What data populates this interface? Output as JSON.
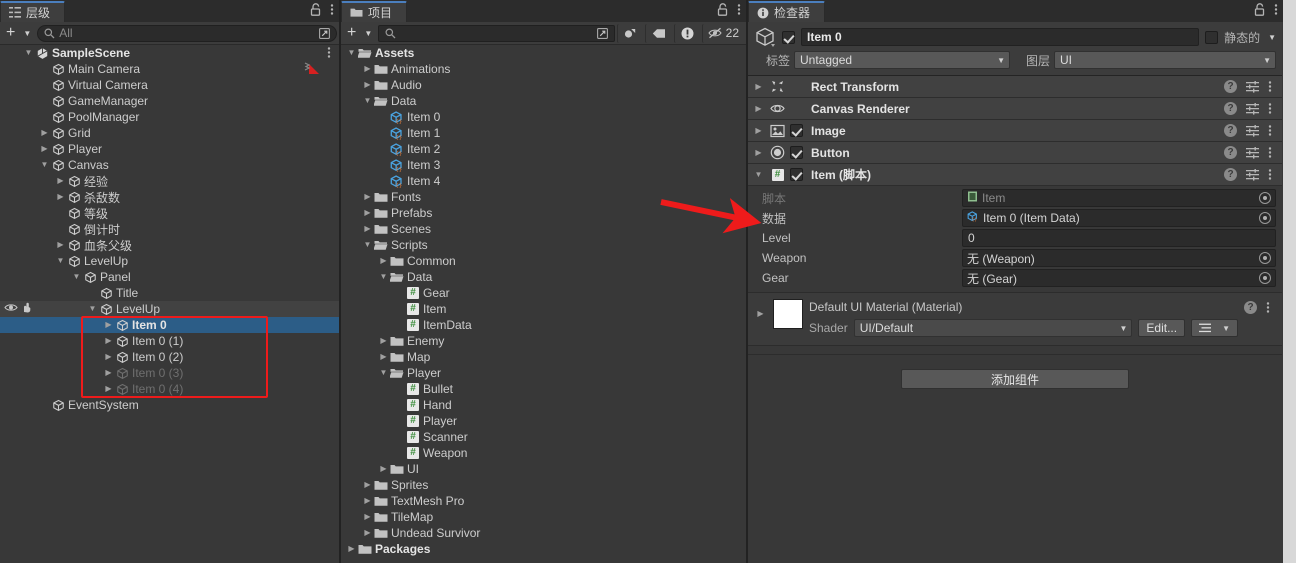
{
  "hierarchy": {
    "tab_label": "层级",
    "search_placeholder": "All",
    "add_label": "+",
    "items": [
      {
        "label": "SampleScene",
        "depth": 1,
        "tri": "down",
        "icon": "unity-scene-icon",
        "bold": true,
        "dim": false,
        "sel": false
      },
      {
        "label": "Main Camera",
        "depth": 2,
        "tri": "none",
        "icon": "gameobject-cube-icon",
        "bold": false,
        "dim": false,
        "sel": false
      },
      {
        "label": "Virtual Camera",
        "depth": 2,
        "tri": "none",
        "icon": "gameobject-cube-icon",
        "bold": false,
        "dim": false,
        "sel": false
      },
      {
        "label": "GameManager",
        "depth": 2,
        "tri": "none",
        "icon": "gameobject-cube-icon",
        "bold": false,
        "dim": false,
        "sel": false
      },
      {
        "label": "PoolManager",
        "depth": 2,
        "tri": "none",
        "icon": "gameobject-cube-icon",
        "bold": false,
        "dim": false,
        "sel": false
      },
      {
        "label": "Grid",
        "depth": 2,
        "tri": "right",
        "icon": "gameobject-cube-icon",
        "bold": false,
        "dim": false,
        "sel": false
      },
      {
        "label": "Player",
        "depth": 2,
        "tri": "right",
        "icon": "gameobject-cube-icon",
        "bold": false,
        "dim": false,
        "sel": false
      },
      {
        "label": "Canvas",
        "depth": 2,
        "tri": "down",
        "icon": "gameobject-cube-icon",
        "bold": false,
        "dim": false,
        "sel": false
      },
      {
        "label": "经验",
        "depth": 3,
        "tri": "right",
        "icon": "gameobject-cube-icon",
        "bold": false,
        "dim": false,
        "sel": false
      },
      {
        "label": "杀敌数",
        "depth": 3,
        "tri": "right",
        "icon": "gameobject-cube-icon",
        "bold": false,
        "dim": false,
        "sel": false
      },
      {
        "label": "等级",
        "depth": 3,
        "tri": "none",
        "icon": "gameobject-cube-icon",
        "bold": false,
        "dim": false,
        "sel": false
      },
      {
        "label": "倒计时",
        "depth": 3,
        "tri": "none",
        "icon": "gameobject-cube-icon",
        "bold": false,
        "dim": false,
        "sel": false
      },
      {
        "label": "血条父级",
        "depth": 3,
        "tri": "right",
        "icon": "gameobject-cube-icon",
        "bold": false,
        "dim": false,
        "sel": false
      },
      {
        "label": "LevelUp",
        "depth": 3,
        "tri": "down",
        "icon": "gameobject-cube-icon",
        "bold": false,
        "dim": false,
        "sel": false
      },
      {
        "label": "Panel",
        "depth": 4,
        "tri": "down",
        "icon": "gameobject-cube-icon",
        "bold": false,
        "dim": false,
        "sel": false
      },
      {
        "label": "Title",
        "depth": 5,
        "tri": "none",
        "icon": "gameobject-cube-icon",
        "bold": false,
        "dim": false,
        "sel": false
      },
      {
        "label": "LevelUp",
        "depth": 5,
        "tri": "down",
        "icon": "gameobject-cube-icon",
        "bold": false,
        "dim": false,
        "sel": false,
        "hover": true
      },
      {
        "label": "Item 0",
        "depth": 6,
        "tri": "right",
        "icon": "gameobject-cube-icon",
        "bold": true,
        "dim": false,
        "sel": true
      },
      {
        "label": "Item 0 (1)",
        "depth": 6,
        "tri": "right",
        "icon": "gameobject-cube-icon",
        "bold": false,
        "dim": false,
        "sel": false
      },
      {
        "label": "Item 0 (2)",
        "depth": 6,
        "tri": "right",
        "icon": "gameobject-cube-icon",
        "bold": false,
        "dim": false,
        "sel": false
      },
      {
        "label": "Item 0 (3)",
        "depth": 6,
        "tri": "right",
        "icon": "gameobject-cube-icon",
        "bold": false,
        "dim": true,
        "sel": false
      },
      {
        "label": "Item 0 (4)",
        "depth": 6,
        "tri": "right",
        "icon": "gameobject-cube-icon",
        "bold": false,
        "dim": true,
        "sel": false
      },
      {
        "label": "EventSystem",
        "depth": 2,
        "tri": "none",
        "icon": "gameobject-cube-icon",
        "bold": false,
        "dim": false,
        "sel": false
      }
    ]
  },
  "project": {
    "tab_label": "项目",
    "search_placeholder": "",
    "add_label": "+",
    "hidden_count": "22",
    "items": [
      {
        "label": "Assets",
        "depth": 0,
        "tri": "down",
        "icon": "folder-open-icon",
        "bold": true
      },
      {
        "label": "Animations",
        "depth": 1,
        "tri": "right",
        "icon": "folder-icon",
        "bold": false
      },
      {
        "label": "Audio",
        "depth": 1,
        "tri": "right",
        "icon": "folder-icon",
        "bold": false
      },
      {
        "label": "Data",
        "depth": 1,
        "tri": "down",
        "icon": "folder-open-icon",
        "bold": false
      },
      {
        "label": "Item 0",
        "depth": 2,
        "tri": "none",
        "icon": "scriptable-object-icon",
        "bold": false
      },
      {
        "label": "Item 1",
        "depth": 2,
        "tri": "none",
        "icon": "scriptable-object-icon",
        "bold": false
      },
      {
        "label": "Item 2",
        "depth": 2,
        "tri": "none",
        "icon": "scriptable-object-icon",
        "bold": false
      },
      {
        "label": "Item 3",
        "depth": 2,
        "tri": "none",
        "icon": "scriptable-object-icon",
        "bold": false
      },
      {
        "label": "Item 4",
        "depth": 2,
        "tri": "none",
        "icon": "scriptable-object-icon",
        "bold": false
      },
      {
        "label": "Fonts",
        "depth": 1,
        "tri": "right",
        "icon": "folder-icon",
        "bold": false
      },
      {
        "label": "Prefabs",
        "depth": 1,
        "tri": "right",
        "icon": "folder-icon",
        "bold": false
      },
      {
        "label": "Scenes",
        "depth": 1,
        "tri": "right",
        "icon": "folder-icon",
        "bold": false
      },
      {
        "label": "Scripts",
        "depth": 1,
        "tri": "down",
        "icon": "folder-open-icon",
        "bold": false
      },
      {
        "label": "Common",
        "depth": 2,
        "tri": "right",
        "icon": "folder-icon",
        "bold": false
      },
      {
        "label": "Data",
        "depth": 2,
        "tri": "down",
        "icon": "folder-open-icon",
        "bold": false
      },
      {
        "label": "Gear",
        "depth": 3,
        "tri": "none",
        "icon": "csharp-script-icon",
        "bold": false
      },
      {
        "label": "Item",
        "depth": 3,
        "tri": "none",
        "icon": "csharp-script-icon",
        "bold": false
      },
      {
        "label": "ItemData",
        "depth": 3,
        "tri": "none",
        "icon": "csharp-script-icon",
        "bold": false
      },
      {
        "label": "Enemy",
        "depth": 2,
        "tri": "right",
        "icon": "folder-icon",
        "bold": false
      },
      {
        "label": "Map",
        "depth": 2,
        "tri": "right",
        "icon": "folder-icon",
        "bold": false
      },
      {
        "label": "Player",
        "depth": 2,
        "tri": "down",
        "icon": "folder-open-icon",
        "bold": false
      },
      {
        "label": "Bullet",
        "depth": 3,
        "tri": "none",
        "icon": "csharp-script-icon",
        "bold": false
      },
      {
        "label": "Hand",
        "depth": 3,
        "tri": "none",
        "icon": "csharp-script-icon",
        "bold": false
      },
      {
        "label": "Player",
        "depth": 3,
        "tri": "none",
        "icon": "csharp-script-icon",
        "bold": false
      },
      {
        "label": "Scanner",
        "depth": 3,
        "tri": "none",
        "icon": "csharp-script-icon",
        "bold": false
      },
      {
        "label": "Weapon",
        "depth": 3,
        "tri": "none",
        "icon": "csharp-script-icon",
        "bold": false
      },
      {
        "label": "UI",
        "depth": 2,
        "tri": "right",
        "icon": "folder-icon",
        "bold": false
      },
      {
        "label": "Sprites",
        "depth": 1,
        "tri": "right",
        "icon": "folder-icon",
        "bold": false
      },
      {
        "label": "TextMesh Pro",
        "depth": 1,
        "tri": "right",
        "icon": "folder-icon",
        "bold": false
      },
      {
        "label": "TileMap",
        "depth": 1,
        "tri": "right",
        "icon": "folder-icon",
        "bold": false
      },
      {
        "label": "Undead Survivor",
        "depth": 1,
        "tri": "right",
        "icon": "folder-icon",
        "bold": false
      },
      {
        "label": "Packages",
        "depth": 0,
        "tri": "right",
        "icon": "folder-icon",
        "bold": true
      }
    ]
  },
  "inspector": {
    "tab_label": "检查器",
    "object_name": "Item 0",
    "object_enabled": true,
    "static_label": "静态的",
    "tag_label": "标签",
    "tag_value": "Untagged",
    "layer_label": "图层",
    "layer_value": "UI",
    "components": [
      {
        "title": "Rect Transform",
        "icon": "rect-transform-icon",
        "expanded": false,
        "has_checkbox": false,
        "checked": false
      },
      {
        "title": "Canvas Renderer",
        "icon": "eye-icon",
        "expanded": false,
        "has_checkbox": false,
        "checked": false
      },
      {
        "title": "Image",
        "icon": "image-icon",
        "expanded": false,
        "has_checkbox": true,
        "checked": true
      },
      {
        "title": "Button",
        "icon": "button-icon",
        "expanded": false,
        "has_checkbox": true,
        "checked": true
      },
      {
        "title": "Item  (脚本)",
        "icon": "csharp-script-icon",
        "expanded": true,
        "has_checkbox": true,
        "checked": true
      }
    ],
    "item_properties": [
      {
        "label": "脚本",
        "value": "Item",
        "type": "object",
        "icon": "csharp-script-icon",
        "dim": true
      },
      {
        "label": "数据",
        "value": "Item 0 (Item Data)",
        "type": "object",
        "icon": "scriptable-object-icon",
        "dim": false
      },
      {
        "label": "Level",
        "value": "0",
        "type": "number",
        "icon": "",
        "dim": false
      },
      {
        "label": "Weapon",
        "value": "无 (Weapon)",
        "type": "object",
        "icon": "",
        "dim": false
      },
      {
        "label": "Gear",
        "value": "无 (Gear)",
        "type": "object",
        "icon": "",
        "dim": false
      }
    ],
    "material": {
      "title": "Default UI Material (Material)",
      "shader_label": "Shader",
      "shader_value": "UI/Default",
      "edit_label": "Edit...",
      "swatch_color": "#ffffff"
    },
    "add_component_label": "添加组件"
  },
  "annotations": {
    "arrow_color": "#ee1b1b",
    "box_color": "#ee1b1b"
  }
}
